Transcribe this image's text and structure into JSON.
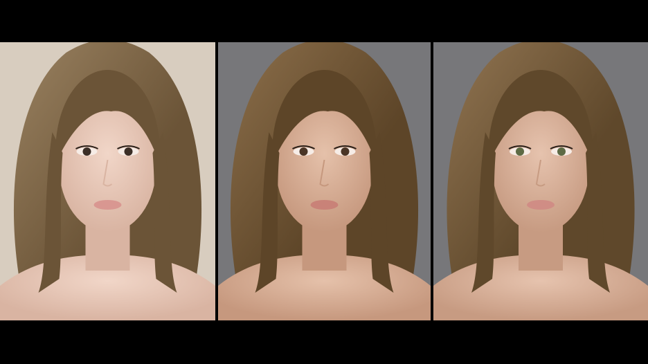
{
  "figure": {
    "panels": [
      {
        "id": "render-1",
        "background": "#d8cdbf",
        "hair_color": "#6b5437",
        "hair_highlight": "#9a8261",
        "skin": "#f1d6c8",
        "skin_shadow": "#d9b4a2",
        "eye_color": "#3b2e26",
        "lip_color": "#d99791"
      },
      {
        "id": "render-2",
        "background": "#77777a",
        "hair_color": "#5d4528",
        "hair_highlight": "#8c6f4b",
        "skin": "#e5c1aa",
        "skin_shadow": "#c6987e",
        "eye_color": "#4a3526",
        "lip_color": "#c98278"
      },
      {
        "id": "render-3",
        "background": "#77777a",
        "hair_color": "#5f482b",
        "hair_highlight": "#917552",
        "skin": "#e6c3ae",
        "skin_shadow": "#c79b82",
        "eye_color": "#5d6a44",
        "lip_color": "#d08d85"
      }
    ]
  }
}
